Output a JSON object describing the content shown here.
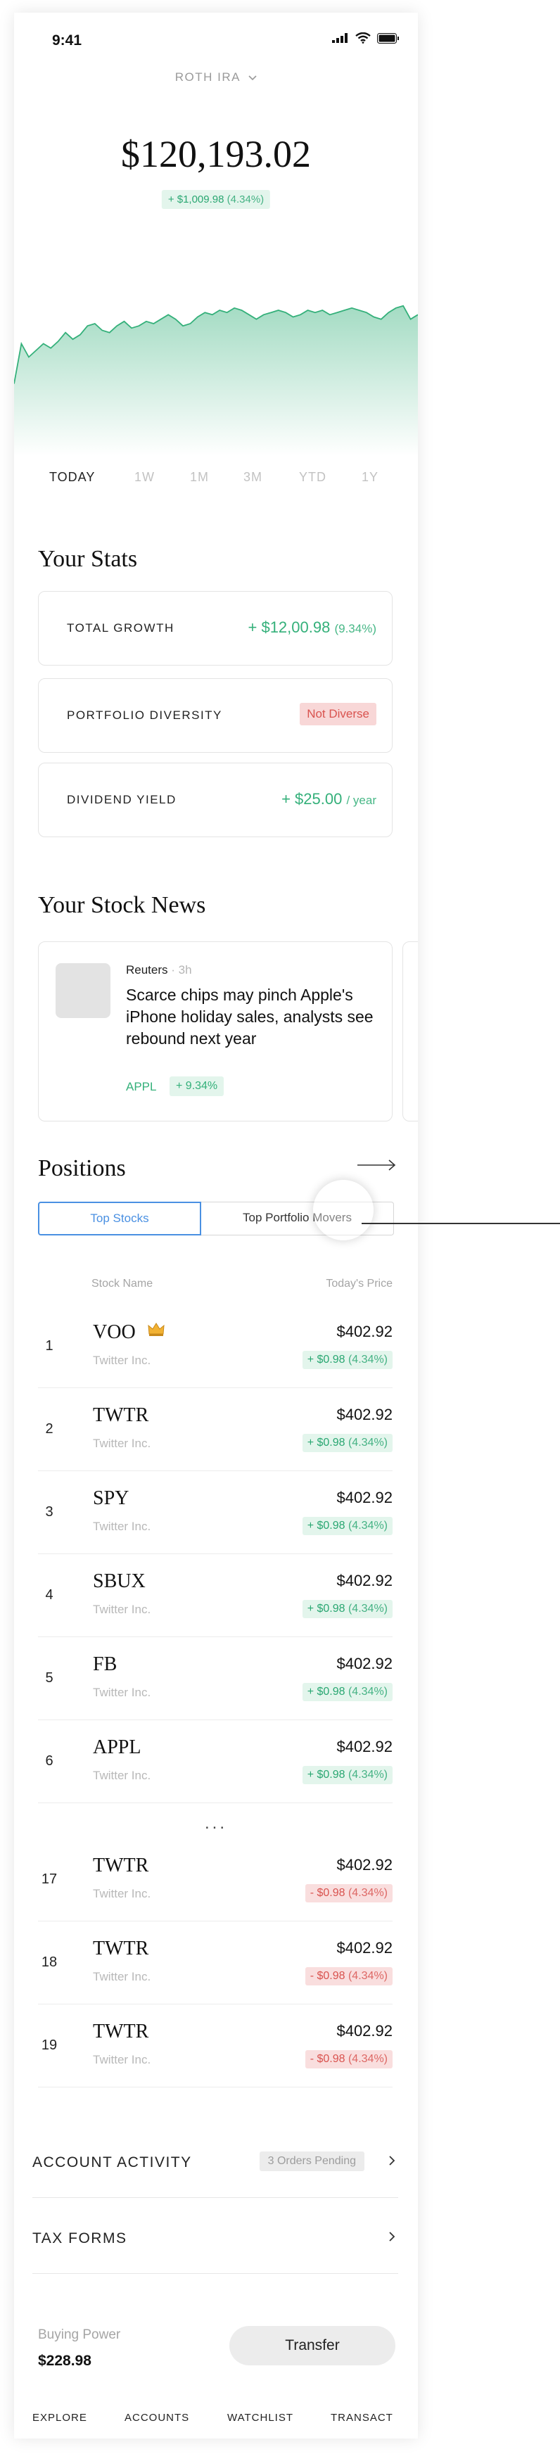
{
  "status_bar": {
    "time": "9:41"
  },
  "account": {
    "name": "ROTH IRA"
  },
  "balance": {
    "value": "$120,193.02",
    "change_amount": "+ $1,009.98",
    "change_pct": "(4.34%)"
  },
  "colors": {
    "accent_green": "#34b07a",
    "negative_red": "#d9534f",
    "selected_blue": "#4a90e2"
  },
  "chart_data": {
    "type": "area",
    "x": [
      0,
      1,
      2,
      3,
      4,
      5,
      6,
      7,
      8,
      9,
      10,
      11,
      12,
      13,
      14,
      15,
      16,
      17,
      18,
      19,
      20,
      21,
      22,
      23,
      24,
      25,
      26,
      27,
      28,
      29,
      30,
      31,
      32,
      33,
      34,
      35,
      36,
      37,
      38,
      39,
      40,
      41,
      42,
      43,
      44,
      45,
      46,
      47,
      48,
      49,
      50,
      51,
      52,
      53,
      54,
      55
    ],
    "series": [
      {
        "values": [
          95,
          113,
          107,
          110,
          113,
          111,
          114,
          118,
          115,
          117,
          121,
          122,
          119,
          118,
          121,
          123,
          120,
          121,
          123,
          122,
          124,
          126,
          124,
          121,
          122,
          125,
          127,
          126,
          128,
          127,
          129,
          128,
          126,
          124,
          126,
          127,
          128,
          127,
          125,
          126,
          128,
          127,
          128,
          126,
          127,
          128,
          129,
          128,
          127,
          125,
          124,
          127,
          129,
          130,
          124,
          126
        ]
      }
    ],
    "grid": false
  },
  "ranges": [
    "TODAY",
    "1W",
    "1M",
    "3M",
    "YTD",
    "1Y"
  ],
  "stats": {
    "title": "Your Stats",
    "total_growth": {
      "label": "TOTAL GROWTH",
      "value": "+ $12,00.98",
      "pct": "(9.34%)"
    },
    "diversity": {
      "label": "PORTFOLIO DIVERSITY",
      "badge": "Not Diverse"
    },
    "dividend": {
      "label": "DIVIDEND YIELD",
      "value": "+ $25.00",
      "unit": "/ year"
    }
  },
  "news": {
    "title": "Your Stock News",
    "items": [
      {
        "source": "Reuters",
        "dot": "·",
        "age": "3h",
        "headline": "Scarce chips may pinch Apple's iPhone holiday sales, analysts see rebound next year",
        "ticker": "APPL",
        "change": "+ 9.34%"
      }
    ]
  },
  "positions": {
    "title": "Positions",
    "segments": [
      "Top Stocks",
      "Top Portfolio Movers"
    ],
    "col_name": "Stock Name",
    "col_price": "Today's Price",
    "ellipsis": "...",
    "rows": [
      {
        "rank": "1",
        "ticker": "VOO",
        "company": "Twitter Inc.",
        "price": "$402.92",
        "change": "+ $0.98",
        "pct": "(4.34%)",
        "direction": "up",
        "icon": "crown-icon"
      },
      {
        "rank": "2",
        "ticker": "TWTR",
        "company": "Twitter Inc.",
        "price": "$402.92",
        "change": "+ $0.98",
        "pct": "(4.34%)",
        "direction": "up"
      },
      {
        "rank": "3",
        "ticker": "SPY",
        "company": "Twitter Inc.",
        "price": "$402.92",
        "change": "+ $0.98",
        "pct": "(4.34%)",
        "direction": "up"
      },
      {
        "rank": "4",
        "ticker": "SBUX",
        "company": "Twitter Inc.",
        "price": "$402.92",
        "change": "+ $0.98",
        "pct": "(4.34%)",
        "direction": "up"
      },
      {
        "rank": "5",
        "ticker": "FB",
        "company": "Twitter Inc.",
        "price": "$402.92",
        "change": "+ $0.98",
        "pct": "(4.34%)",
        "direction": "up"
      },
      {
        "rank": "6",
        "ticker": "APPL",
        "company": "Twitter Inc.",
        "price": "$402.92",
        "change": "+ $0.98",
        "pct": "(4.34%)",
        "direction": "up"
      },
      {
        "rank": "17",
        "ticker": "TWTR",
        "company": "Twitter Inc.",
        "price": "$402.92",
        "change": "- $0.98",
        "pct": "(4.34%)",
        "direction": "down"
      },
      {
        "rank": "18",
        "ticker": "TWTR",
        "company": "Twitter Inc.",
        "price": "$402.92",
        "change": "- $0.98",
        "pct": "(4.34%)",
        "direction": "down"
      },
      {
        "rank": "19",
        "ticker": "TWTR",
        "company": "Twitter Inc.",
        "price": "$402.92",
        "change": "- $0.98",
        "pct": "(4.34%)",
        "direction": "down"
      }
    ]
  },
  "account_activity": {
    "label": "ACCOUNT ACTIVITY",
    "pending": "3 Orders Pending"
  },
  "tax_forms": {
    "label": "TAX FORMS"
  },
  "buying_power": {
    "label": "Buying Power",
    "value": "$228.98",
    "button": "Transfer"
  },
  "tabs": [
    "EXPLORE",
    "ACCOUNTS",
    "WATCHLIST",
    "TRANSACT"
  ]
}
